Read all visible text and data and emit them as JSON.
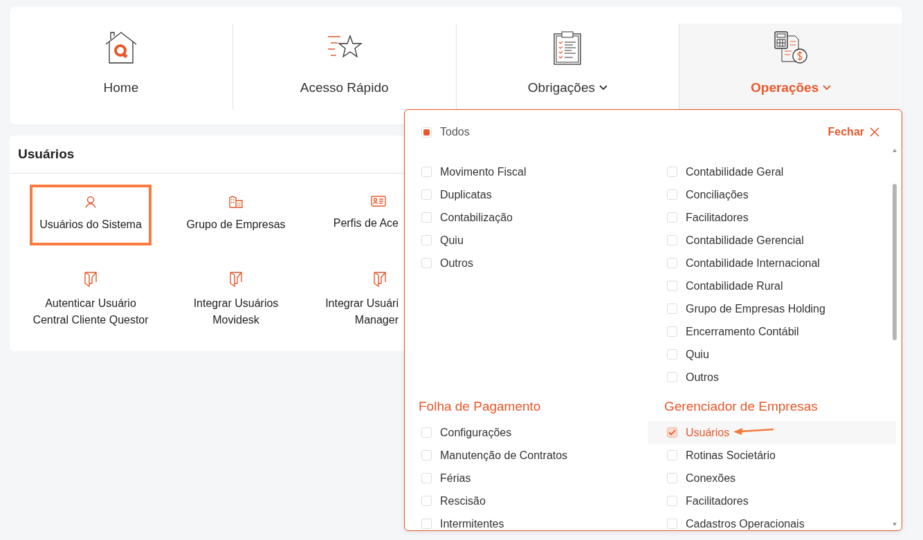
{
  "nav": [
    {
      "label": "Home",
      "has_menu": false,
      "selected": false
    },
    {
      "label": "Acesso Rápido",
      "has_menu": false,
      "selected": false
    },
    {
      "label": "Obrigações",
      "has_menu": true,
      "selected": false
    },
    {
      "label": "Operações",
      "has_menu": true,
      "selected": true
    }
  ],
  "panel": {
    "title": "Usuários",
    "tiles": [
      {
        "lines": [
          "Usuários do Sistema"
        ],
        "selected": true
      },
      {
        "lines": [
          "Grupo de Empresas"
        ],
        "selected": false
      },
      {
        "lines": [
          "Perfis de Ace"
        ],
        "selected": false
      },
      {
        "lines": [
          "Autenticar Usuário",
          "Central Cliente Questor"
        ],
        "selected": false
      },
      {
        "lines": [
          "Integrar Usuários",
          "Movidesk"
        ],
        "selected": false
      },
      {
        "lines": [
          "Integrar Usuári",
          "Manager"
        ],
        "selected": false
      }
    ]
  },
  "dropdown": {
    "all": {
      "label": "Todos",
      "partial": true
    },
    "close": "Fechar",
    "blocks": [
      {
        "columns": [
          {
            "items": [
              {
                "label": "Movimento Fiscal",
                "checked": false
              },
              {
                "label": "Duplicatas",
                "checked": false
              },
              {
                "label": "Contabilização",
                "checked": false
              },
              {
                "label": "Quiu",
                "checked": false
              },
              {
                "label": "Outros",
                "checked": false
              }
            ]
          },
          {
            "items": [
              {
                "label": "Contabilidade Geral",
                "checked": false
              },
              {
                "label": "Conciliações",
                "checked": false
              },
              {
                "label": "Facilitadores",
                "checked": false
              },
              {
                "label": "Contabilidade Gerencial",
                "checked": false
              },
              {
                "label": "Contabilidade Internacional",
                "checked": false
              },
              {
                "label": "Contabilidade Rural",
                "checked": false
              },
              {
                "label": "Grupo de Empresas Holding",
                "checked": false
              },
              {
                "label": "Encerramento Contábil",
                "checked": false
              },
              {
                "label": "Quiu",
                "checked": false
              },
              {
                "label": "Outros",
                "checked": false
              }
            ]
          }
        ]
      },
      {
        "columns": [
          {
            "heading": "Folha de Pagamento",
            "items": [
              {
                "label": "Configurações",
                "checked": false
              },
              {
                "label": "Manutenção de Contratos",
                "checked": false
              },
              {
                "label": "Férias",
                "checked": false
              },
              {
                "label": "Rescisão",
                "checked": false
              },
              {
                "label": "Intermitentes",
                "checked": false
              }
            ]
          },
          {
            "heading": "Gerenciador de Empresas",
            "items": [
              {
                "label": "Usuários",
                "checked": true,
                "pointed": true
              },
              {
                "label": "Rotinas Societário",
                "checked": false
              },
              {
                "label": "Conexões",
                "checked": false
              },
              {
                "label": "Facilitadores",
                "checked": false
              },
              {
                "label": "Cadastros Operacionais",
                "checked": false
              }
            ]
          }
        ]
      }
    ]
  }
}
